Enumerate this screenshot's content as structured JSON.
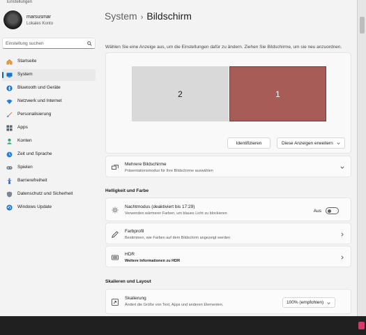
{
  "window": {
    "title": "Einstellungen"
  },
  "user": {
    "name": "marsusmar",
    "account_type": "Lokales Konto"
  },
  "search": {
    "placeholder": "Einstellung suchen"
  },
  "sidebar": {
    "items": [
      {
        "label": "Startseite",
        "icon": "home-icon",
        "active": false
      },
      {
        "label": "System",
        "icon": "monitor-icon",
        "active": true
      },
      {
        "label": "Bluetooth und Geräte",
        "icon": "bluetooth-icon",
        "active": false
      },
      {
        "label": "Netzwerk und Internet",
        "icon": "wifi-icon",
        "active": false
      },
      {
        "label": "Personalisierung",
        "icon": "brush-icon",
        "active": false
      },
      {
        "label": "Apps",
        "icon": "apps-icon",
        "active": false
      },
      {
        "label": "Konten",
        "icon": "person-icon",
        "active": false
      },
      {
        "label": "Zeit und Sprache",
        "icon": "globe-clock-icon",
        "active": false
      },
      {
        "label": "Spielen",
        "icon": "gamepad-icon",
        "active": false
      },
      {
        "label": "Barrierefreiheit",
        "icon": "accessibility-icon",
        "active": false
      },
      {
        "label": "Datenschutz und Sicherheit",
        "icon": "shield-icon",
        "active": false
      },
      {
        "label": "Windows Update",
        "icon": "update-icon",
        "active": false
      }
    ]
  },
  "header": {
    "breadcrumb_parent": "System",
    "breadcrumb_separator": "›",
    "page_title": "Bildschirm"
  },
  "arrangement": {
    "hint": "Wählen Sie eine Anzeige aus, um die Einstellungen dafür zu ändern. Ziehen Sie Bildschirme, um sie neu anzuordnen.",
    "monitors": [
      {
        "number": "2",
        "selected": false
      },
      {
        "number": "1",
        "selected": true
      }
    ],
    "identify_label": "Identifizieren",
    "mode_label": "Diese Anzeigen erweitern"
  },
  "multi_display": {
    "title": "Mehrere Bildschirme",
    "subtitle": "Präsentationsmodus für Ihre Bildschirme auswählen"
  },
  "brightness_section": {
    "heading": "Helligkeit und Farbe"
  },
  "night_light": {
    "title": "Nachtmodus (deaktiviert bis 17:29)",
    "subtitle": "Verwenden wärmerer Farben, um blaues Licht zu blockieren",
    "toggle_label": "Aus",
    "enabled": false
  },
  "color_profile": {
    "title": "Farbprofil",
    "subtitle": "Bestimmen, wie Farben auf dem Bildschirm angezeigt werden"
  },
  "hdr": {
    "title": "HDR",
    "subtitle": "Weitere Informationen zu HDR"
  },
  "scale_section": {
    "heading": "Skalieren und Layout"
  },
  "scaling": {
    "title": "Skalierung",
    "subtitle": "Ändert die Größe von Text, Apps und anderen Elementen.",
    "value": "100% (empfohlen)"
  },
  "colors": {
    "accent": "#0067c0",
    "selected_monitor": "#a85c58",
    "unselected_monitor": "#d9d9d9"
  }
}
